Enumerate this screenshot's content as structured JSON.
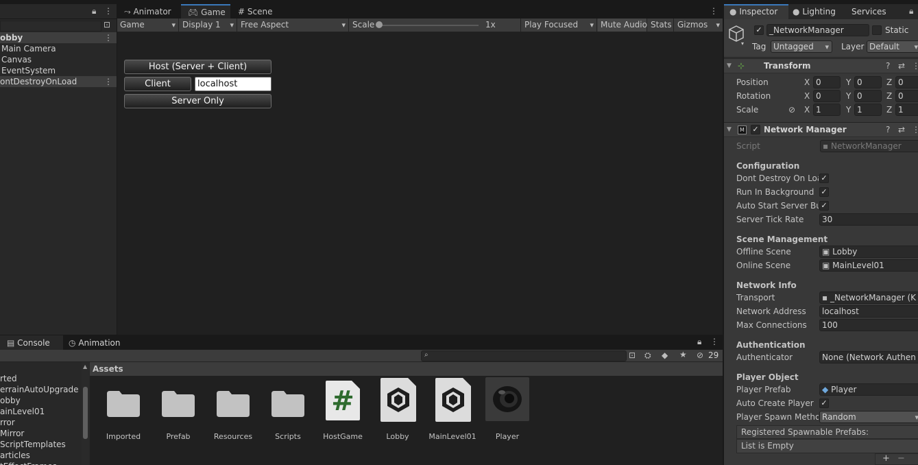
{
  "hierarchy": {
    "scene_name": "obby",
    "items": [
      "Main Camera",
      "Canvas",
      "EventSystem",
      "ontDestroyOnLoad"
    ]
  },
  "game_tabs": [
    {
      "label": "Animator"
    },
    {
      "label": "Game"
    },
    {
      "label": "Scene"
    }
  ],
  "game_toolbar": {
    "mode": "Game",
    "display": "Display 1",
    "aspect": "Free Aspect",
    "scale_label": "Scale",
    "scale_value": "1x",
    "scale_fraction": 0.0,
    "play_focused": "Play Focused",
    "mute_audio": "Mute Audio",
    "stats": "Stats",
    "gizmos": "Gizmos"
  },
  "game_ui": {
    "host_button": "Host (Server + Client)",
    "client_button": "Client",
    "address_value": "localhost",
    "server_button": "Server Only"
  },
  "bottom": {
    "tabs": [
      "Console",
      "Animation"
    ],
    "hidden_count": "29",
    "folders": [
      "rted",
      "errainAutoUpgrade",
      "obby",
      "ainLevel01",
      "rror",
      "Mirror",
      "ScriptTemplates",
      "articles",
      "tEffectFrames"
    ],
    "assets_title": "Assets",
    "assets": [
      {
        "label": "Imported",
        "kind": "folder"
      },
      {
        "label": "Prefab",
        "kind": "folder"
      },
      {
        "label": "Resources",
        "kind": "folder"
      },
      {
        "label": "Scripts",
        "kind": "folder"
      },
      {
        "label": "HostGame",
        "kind": "script"
      },
      {
        "label": "Lobby",
        "kind": "scene"
      },
      {
        "label": "MainLevel01",
        "kind": "scene"
      },
      {
        "label": "Player",
        "kind": "prefab"
      }
    ]
  },
  "inspector": {
    "tabs": [
      "Inspector",
      "Lighting",
      "Services"
    ],
    "object_name": "_NetworkManager",
    "static_label": "Static",
    "tag_label": "Tag",
    "tag_value": "Untagged",
    "layer_label": "Layer",
    "layer_value": "Default",
    "transform": {
      "title": "Transform",
      "rows": [
        {
          "label": "Position",
          "x": "0",
          "y": "0",
          "z": "0"
        },
        {
          "label": "Rotation",
          "x": "0",
          "y": "0",
          "z": "0"
        },
        {
          "label": "Scale",
          "x": "1",
          "y": "1",
          "z": "1"
        }
      ]
    },
    "network_manager": {
      "title": "Network Manager",
      "script_label": "Script",
      "script_value": "NetworkManager",
      "configuration": "Configuration",
      "dont_destroy": "Dont Destroy On Load",
      "run_in_background": "Run In Background",
      "auto_start": "Auto Start Server Build",
      "tick_rate_label": "Server Tick Rate",
      "tick_rate_value": "30",
      "scene_management": "Scene Management",
      "offline_label": "Offline Scene",
      "offline_value": "Lobby",
      "online_label": "Online Scene",
      "online_value": "MainLevel01",
      "network_info": "Network Info",
      "transport_label": "Transport",
      "transport_value": "_NetworkManager (K",
      "address_label": "Network Address",
      "address_value": "localhost",
      "max_conn_label": "Max Connections",
      "max_conn_value": "100",
      "authentication": "Authentication",
      "authenticator_label": "Authenticator",
      "authenticator_value": "None (Network Authen",
      "player_object": "Player Object",
      "player_prefab_label": "Player Prefab",
      "player_prefab_value": "Player",
      "auto_create_label": "Auto Create Player",
      "spawn_method_label": "Player Spawn Method",
      "spawn_method_value": "Random",
      "registered_label": "Registered Spawnable Prefabs:",
      "list_empty": "List is Empty"
    }
  }
}
